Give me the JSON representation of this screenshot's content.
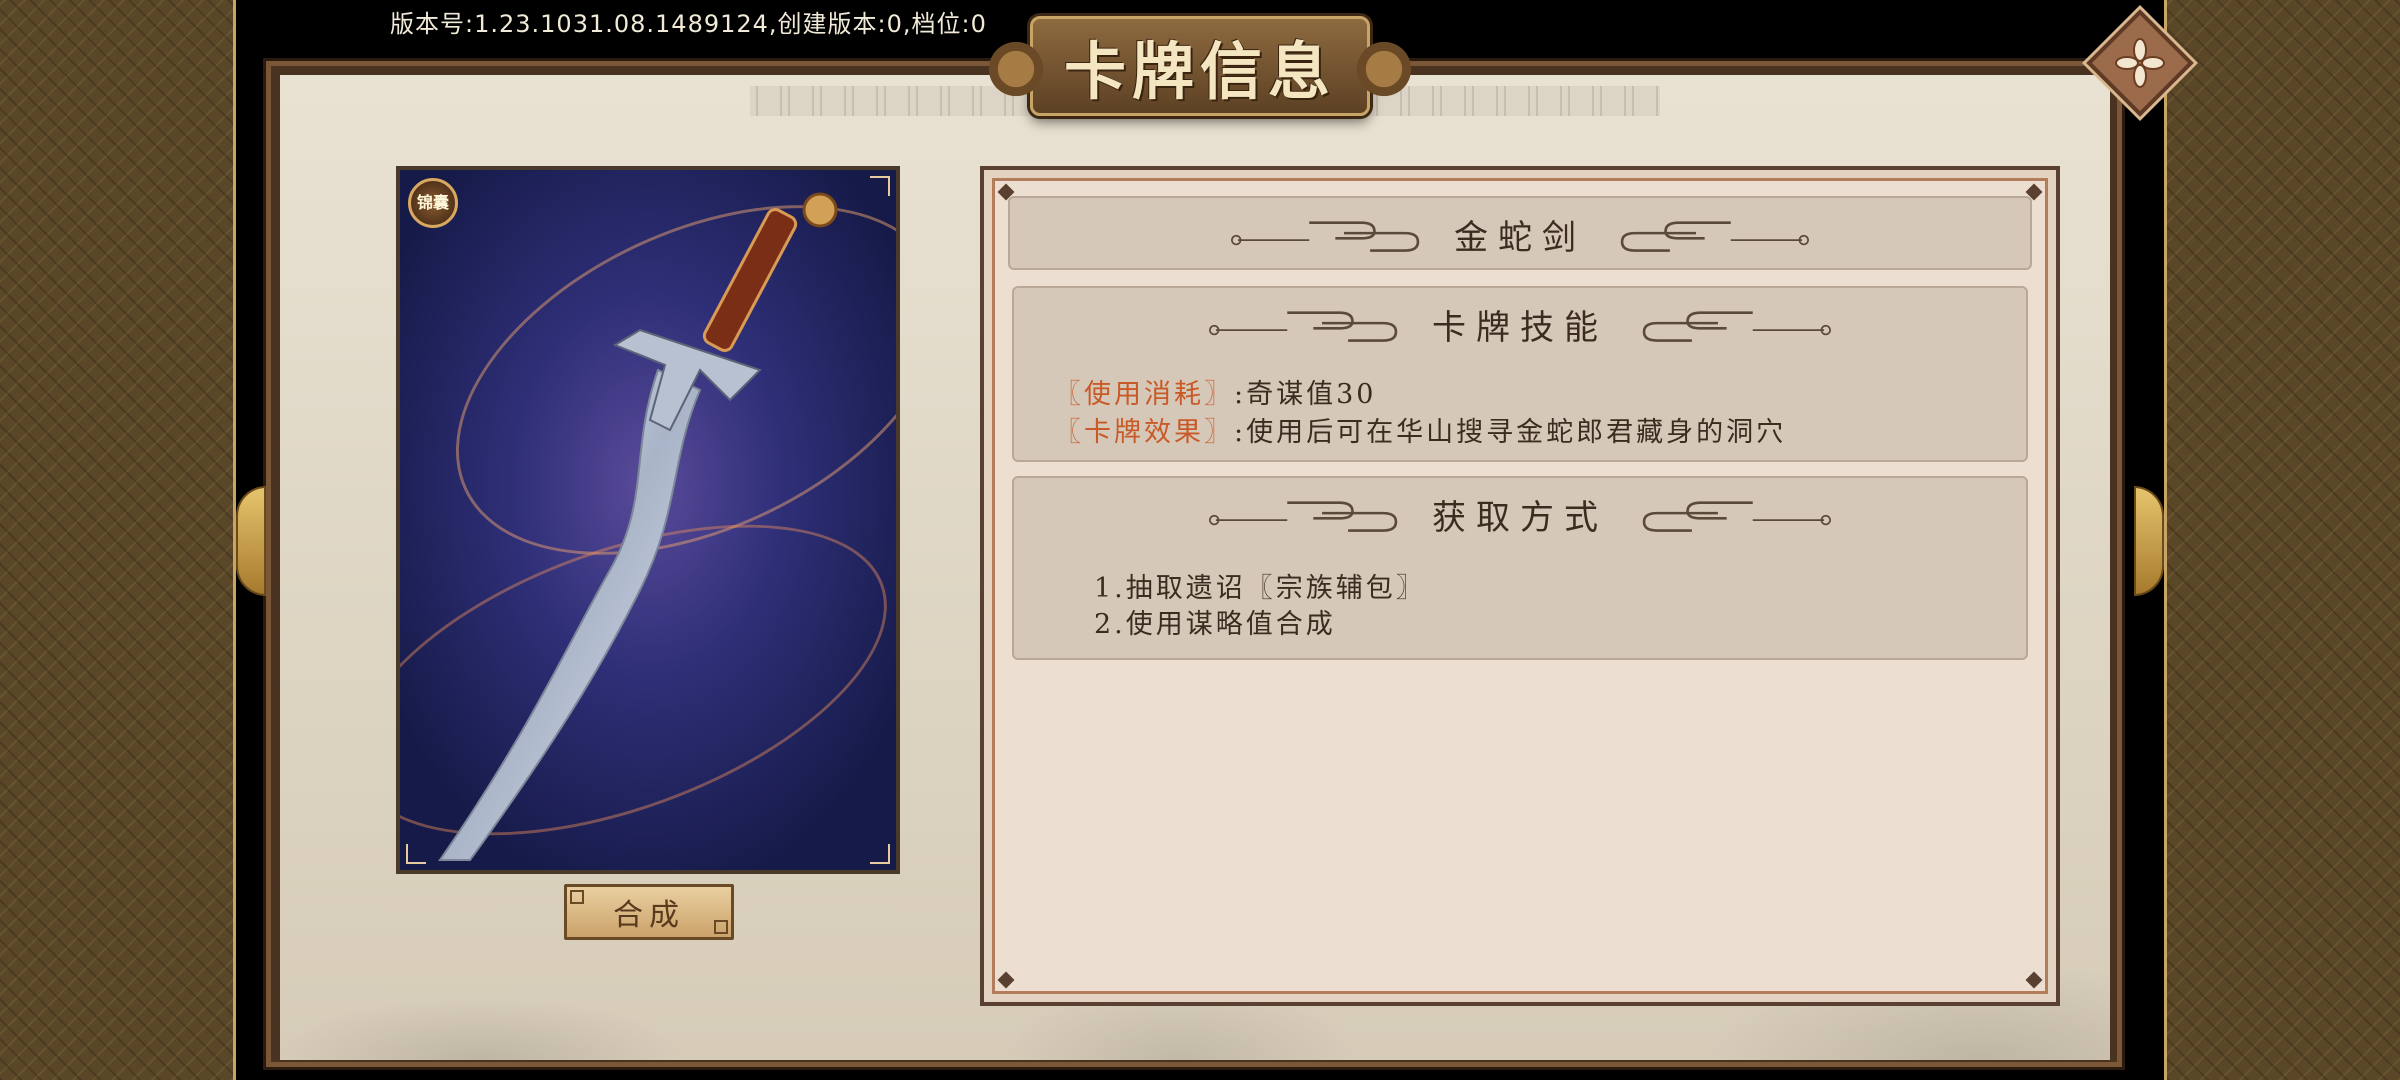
{
  "version_line": "版本号:1.23.1031.08.1489124,创建版本:0,档位:0",
  "title": "卡牌信息",
  "card": {
    "badge": "锦囊",
    "compose_label": "合成"
  },
  "info": {
    "card_name": "金蛇剑",
    "skill_section": {
      "title": "卡牌技能",
      "lines": [
        {
          "key": "〖使用消耗〗",
          "sep": ":",
          "value": "奇谋值30"
        },
        {
          "key": "〖卡牌效果〗",
          "sep": ":",
          "value": "使用后可在华山搜寻金蛇郎君藏身的洞穴"
        }
      ]
    },
    "source_section": {
      "title": "获取方式",
      "lines": [
        "1.抽取遗诏〖宗族辅包〗",
        "2.使用谋略值合成"
      ]
    }
  },
  "icons": {
    "close": "close-icon",
    "prev": "arrow-left-icon",
    "next": "arrow-right-icon"
  }
}
